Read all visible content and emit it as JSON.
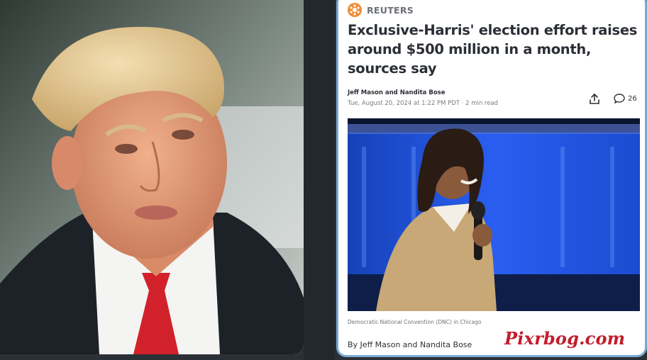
{
  "left_photo": {
    "subject": "man in dark coat, white shirt and red tie"
  },
  "article": {
    "source": "REUTERS",
    "source_icon": "reuters-logo-icon",
    "headline": "Exclusive-Harris' election effort raises around $500 million in a month, sources say",
    "authors": "Jeff Mason and Nandita Bose",
    "dateline": "Tue, August 20, 2024 at 1:22 PM PDT  ·  2 min read",
    "share_icon": "share-icon",
    "comment_icon": "comment-icon",
    "comment_count": "26",
    "image_caption": "Democratic National Convention (DNC) in Chicago",
    "byline_bottom": "By Jeff Mason and Nandita Bose"
  },
  "watermark": "Pixrbog.com",
  "colors": {
    "accent_border": "#7aa9d6",
    "reuters_orange": "#f28b30",
    "watermark_red": "#c21d2c",
    "stage_blue": "#1d4fd8"
  }
}
